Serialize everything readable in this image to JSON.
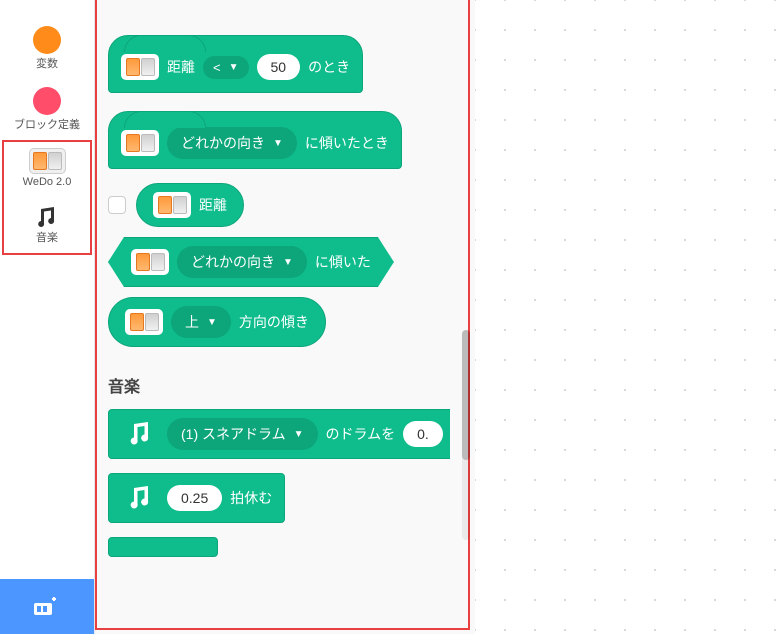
{
  "sidebar": {
    "variables": {
      "label": "変数",
      "color": "#ff8c1a"
    },
    "myblocks": {
      "label": "ブロック定義",
      "color": "#ff4d6a"
    },
    "wedo": {
      "label": "WeDo 2.0"
    },
    "music": {
      "label": "音楽"
    }
  },
  "blocks": {
    "distance_hat": {
      "part1": "距離",
      "op": "<",
      "value": "50",
      "part2": "のとき"
    },
    "tilt_hat": {
      "dropdown": "どれかの向き",
      "suffix": "に傾いたとき"
    },
    "distance_reporter": {
      "label": "距離"
    },
    "tilted_bool": {
      "dropdown": "どれかの向き",
      "suffix": "に傾いた"
    },
    "tilt_angle": {
      "dropdown": "上",
      "suffix": "方向の傾き"
    },
    "music_section": "音楽",
    "play_drum": {
      "dropdown": "(1) スネアドラム",
      "mid": "のドラムを",
      "beats": "0."
    },
    "rest": {
      "beats": "0.25",
      "suffix": "拍休む"
    }
  }
}
